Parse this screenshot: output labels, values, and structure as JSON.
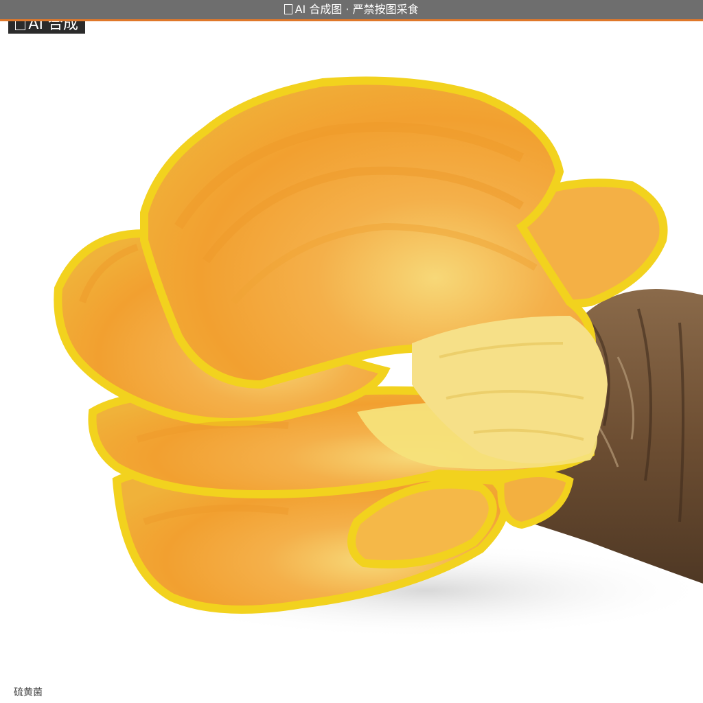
{
  "banner": {
    "icon": "warning-icon",
    "text": "AI 合成图 · 严禁按图采食"
  },
  "badge": {
    "icon": "warning-icon",
    "text": "AI 合成"
  },
  "caption": "硫黄菌",
  "colors": {
    "banner_bg": "#6e6e6e",
    "banner_accent": "#e0782a",
    "fungus_orange": "#f0a232",
    "fungus_yellow": "#f2d21e",
    "log_brown": "#7a5a3c"
  }
}
